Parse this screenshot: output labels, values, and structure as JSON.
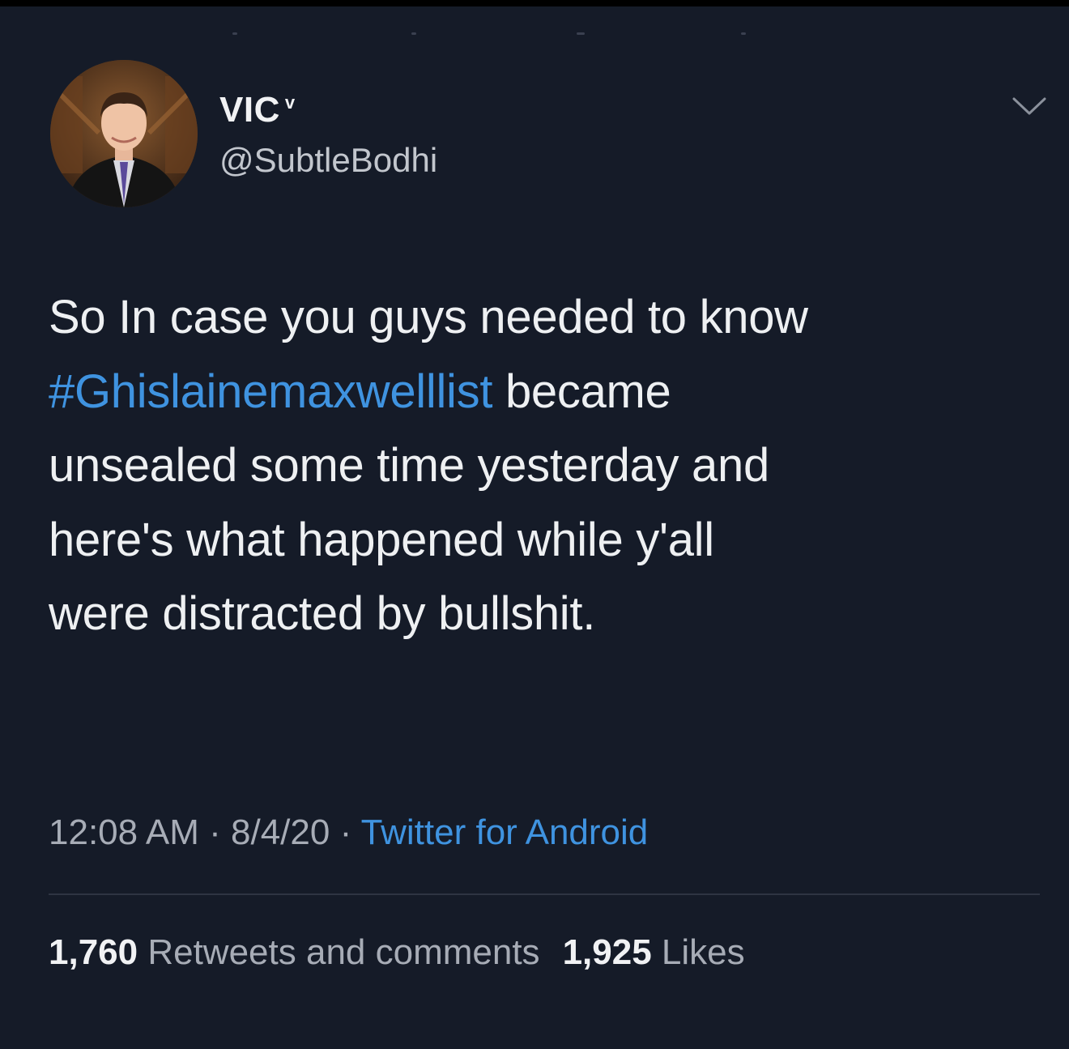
{
  "user": {
    "display_name": "VIC",
    "verified_mark": "v",
    "handle": "@SubtleBodhi"
  },
  "tweet": {
    "line1": "So In case you guys needed to know",
    "hashtag": "#Ghislainemaxwelllist",
    "line2_rest": " became",
    "line3": "unsealed some time yesterday and",
    "line4": "here's what happened while y'all",
    "line5": "were distracted by bullshit."
  },
  "meta": {
    "time": "12:08 AM",
    "separator1": " · ",
    "date": "8/4/20",
    "separator2": " · ",
    "source": "Twitter for Android"
  },
  "stats": {
    "retweets_count": "1,760",
    "retweets_label": " Retweets and comments",
    "likes_count": "1,925",
    "likes_label": " Likes"
  },
  "colors": {
    "background": "#151b28",
    "link": "#3f93e0",
    "text": "#eef0f2",
    "muted": "#a7acb6"
  },
  "icons": {
    "menu": "chevron-down-icon"
  }
}
